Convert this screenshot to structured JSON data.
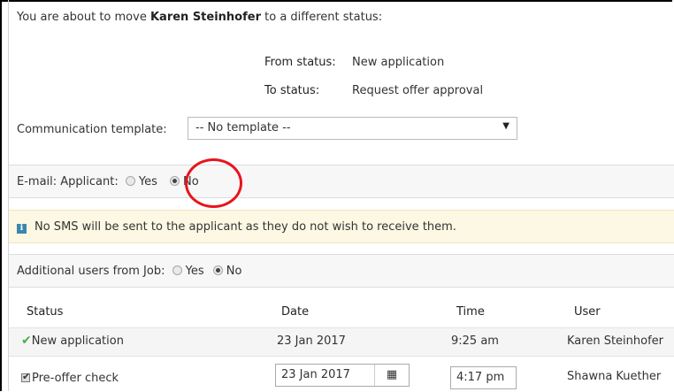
{
  "intro": {
    "prefix": "You are about to move ",
    "name": "Karen Steinhofer",
    "suffix": " to a different status:"
  },
  "status_change": {
    "from_label": "From status:",
    "from_value": "New application",
    "to_label": "To status:",
    "to_value": "Request offer approval"
  },
  "communication_template": {
    "label": "Communication template:",
    "selected": "-- No template --"
  },
  "email_applicant": {
    "label": "E-mail: Applicant:",
    "yes_label": "Yes",
    "no_label": "No",
    "selected": "No"
  },
  "sms_notice": {
    "text": "No SMS will be sent to the applicant as they do not wish to receive them."
  },
  "additional_users": {
    "label": "Additional users from Job:",
    "yes_label": "Yes",
    "no_label": "No",
    "selected": "No"
  },
  "table": {
    "headers": [
      "Status",
      "Date",
      "Time",
      "User"
    ],
    "rows": [
      {
        "status": "New application",
        "date": "23 Jan 2017",
        "time": "9:25 am",
        "user": "Karen Steinhofer"
      },
      {
        "status": "Pre-offer check",
        "date": "23 Jan 2017",
        "time": "4:17 pm",
        "user": "Shawna Kuether"
      }
    ]
  },
  "icons": {
    "completed": "checkmark-icon",
    "calendar": "calendar-icon",
    "info": "info-icon"
  },
  "colors": {
    "highlight_circle": "#e8141c",
    "info_band": "#fcf8e3",
    "checkmark": "#4cae4c"
  }
}
